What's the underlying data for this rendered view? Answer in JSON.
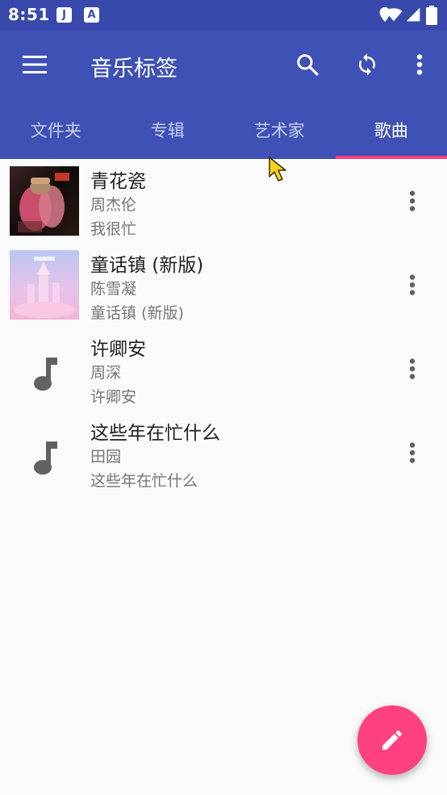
{
  "status_bar": {
    "time": "8:51",
    "notif_1": "J",
    "notif_2": "A"
  },
  "app_bar": {
    "title": "音乐标签",
    "menu_icon": "hamburger-menu-icon",
    "search_icon": "search-icon",
    "sync_icon": "sync-icon",
    "overflow_icon": "more-vertical-icon"
  },
  "tabs": [
    {
      "label": "文件夹",
      "active": false
    },
    {
      "label": "专辑",
      "active": false
    },
    {
      "label": "艺术家",
      "active": false
    },
    {
      "label": "歌曲",
      "active": true
    }
  ],
  "songs": [
    {
      "title": "青花瓷",
      "artist": "周杰伦",
      "album": "我很忙",
      "art": "album-cover"
    },
    {
      "title": "童话镇 (新版)",
      "artist": "陈雪凝",
      "album": "童话镇 (新版)",
      "art": "album-cover"
    },
    {
      "title": "许卿安",
      "artist": "周深",
      "album": "许卿安",
      "art": "music-note-icon"
    },
    {
      "title": "这些年在忙什么",
      "artist": "田园",
      "album": "这些年在忙什么",
      "art": "music-note-icon"
    }
  ],
  "fab": {
    "icon": "edit-pencil-icon"
  },
  "colors": {
    "primary": "#3f51b5",
    "primary_dark": "#3949ab",
    "accent": "#ff4081"
  }
}
